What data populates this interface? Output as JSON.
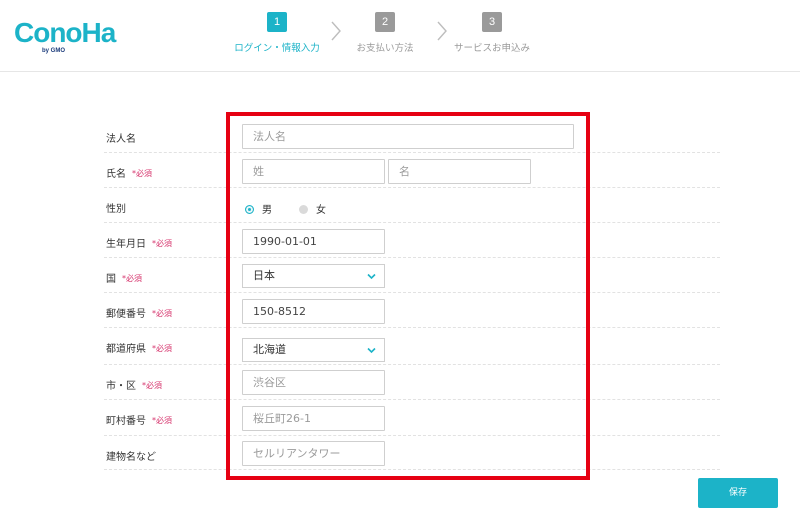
{
  "header": {
    "logo_text": "ConoHa",
    "logo_sub": "by GMO",
    "steps": [
      {
        "num": "1",
        "label": "ログイン・情報入力",
        "state": "active"
      },
      {
        "num": "2",
        "label": "お支払い方法",
        "state": "inactive"
      },
      {
        "num": "3",
        "label": "サービスお申込み",
        "state": "inactive"
      }
    ]
  },
  "form": {
    "required_mark": "*必須",
    "corporate_name": {
      "label": "法人名",
      "placeholder": "法人名"
    },
    "name": {
      "label": "氏名",
      "last_placeholder": "姓",
      "first_placeholder": "名"
    },
    "gender": {
      "label": "性別",
      "options": [
        "男",
        "女"
      ],
      "selected": "男"
    },
    "birthdate": {
      "label": "生年月日",
      "value": "1990-01-01"
    },
    "country": {
      "label": "国",
      "value": "日本"
    },
    "postal_code": {
      "label": "郵便番号",
      "value": "150-8512"
    },
    "prefecture": {
      "label": "都道府県",
      "value": "北海道"
    },
    "city": {
      "label": "市・区",
      "placeholder": "渋谷区"
    },
    "address": {
      "label": "町村番号",
      "placeholder": "桜丘町26-1"
    },
    "building": {
      "label": "建物名など",
      "placeholder": "セルリアンタワー"
    }
  },
  "actions": {
    "save_label": "保存"
  },
  "colors": {
    "accent": "#1cb3c8",
    "required": "#d6336c",
    "highlight": "#e60012",
    "inactive": "#9a9a9a"
  }
}
